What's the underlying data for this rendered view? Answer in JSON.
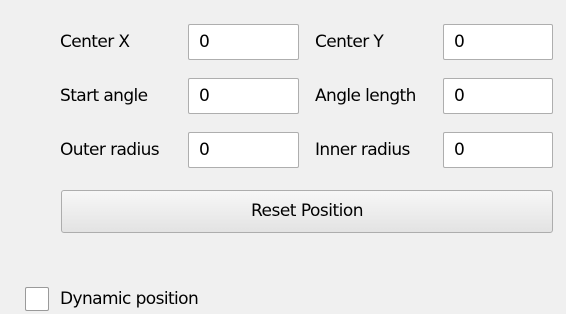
{
  "fields": {
    "center_x": {
      "label": "Center X",
      "value": "0"
    },
    "center_y": {
      "label": "Center Y",
      "value": "0"
    },
    "start_angle": {
      "label": "Start angle",
      "value": "0"
    },
    "angle_length": {
      "label": "Angle length",
      "value": "0"
    },
    "outer_radius": {
      "label": "Outer radius",
      "value": "0"
    },
    "inner_radius": {
      "label": "Inner radius",
      "value": "0"
    }
  },
  "reset_button": {
    "label": "Reset Position"
  },
  "dynamic_position": {
    "label": "Dynamic position",
    "checked": false
  }
}
